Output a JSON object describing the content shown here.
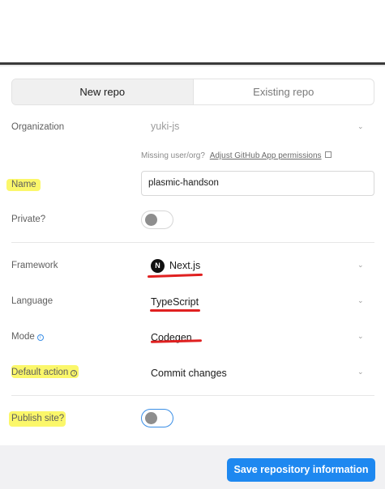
{
  "tabs": [
    {
      "label": "New repo",
      "active": true
    },
    {
      "label": "Existing repo",
      "active": false
    }
  ],
  "organization": {
    "label": "Organization",
    "value": "yuki-js"
  },
  "helper": {
    "text": "Missing user/org?",
    "link": "Adjust GitHub App permissions"
  },
  "name_field": {
    "label": "Name",
    "value": "plasmic-handson"
  },
  "private": {
    "label": "Private?",
    "on": false
  },
  "framework": {
    "label": "Framework",
    "value": "Next.js",
    "logo_letter": "N"
  },
  "language": {
    "label": "Language",
    "value": "TypeScript"
  },
  "mode": {
    "label": "Mode",
    "value": "Codegen",
    "info_glyph": "i"
  },
  "default_action": {
    "label": "Default action",
    "value": "Commit changes",
    "info_glyph": "i"
  },
  "publish": {
    "label": "Publish site?",
    "on": false
  },
  "footer": {
    "save_label": "Save repository information"
  },
  "colors": {
    "accent": "#1e88f0",
    "highlight": "#fbf65a",
    "annotation_red": "#e02020"
  },
  "icons": {
    "chevron": "chevron-down-icon",
    "external": "external-link-icon",
    "info": "info-icon",
    "framework_logo": "nextjs-logo-icon"
  }
}
